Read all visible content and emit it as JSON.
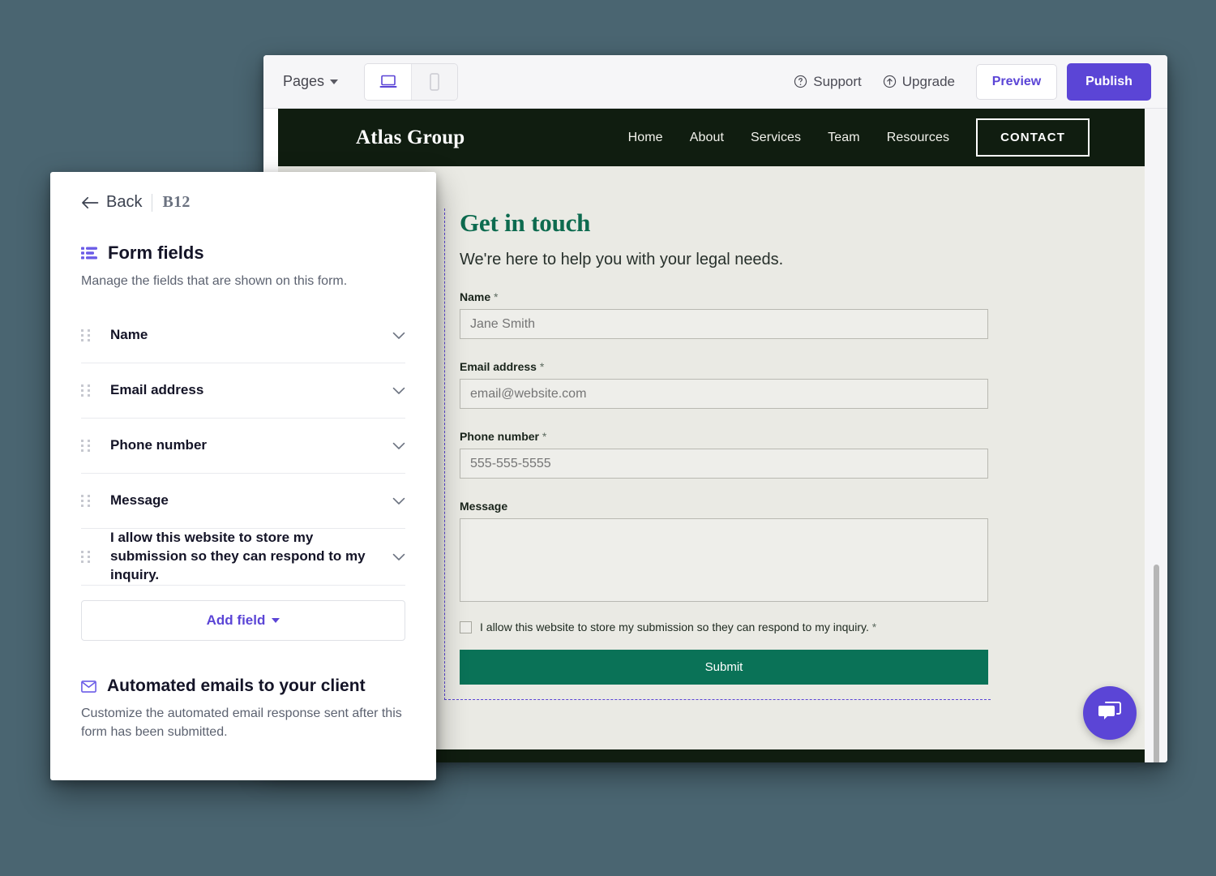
{
  "builder": {
    "toolbar": {
      "pages_label": "Pages",
      "view_desktop_icon": "laptop-icon",
      "view_mobile_icon": "mobile-icon",
      "support_label": "Support",
      "support_icon": "question-circle-icon",
      "upgrade_label": "Upgrade",
      "upgrade_icon": "arrow-up-circle-icon",
      "preview_label": "Preview",
      "publish_label": "Publish",
      "accent_color": "#5b45d6"
    }
  },
  "site": {
    "brand": "Atlas Group",
    "header_bg": "#101d10",
    "nav": [
      {
        "label": "Home"
      },
      {
        "label": "About"
      },
      {
        "label": "Services"
      },
      {
        "label": "Team"
      },
      {
        "label": "Resources"
      }
    ],
    "nav_cta": "CONTACT",
    "page_bg": "#eaeae4",
    "form": {
      "headline": "Get in touch",
      "headline_color": "#0d6b4f",
      "subhead": "We're here to help you with your legal needs.",
      "fields": [
        {
          "label": "Name",
          "required": "*",
          "placeholder": "Jane Smith",
          "type": "text"
        },
        {
          "label": "Email address",
          "required": "*",
          "placeholder": "email@website.com",
          "type": "text"
        },
        {
          "label": "Phone number",
          "required": "*",
          "placeholder": "555-555-5555",
          "type": "text"
        },
        {
          "label": "Message",
          "required": "",
          "placeholder": "",
          "type": "textarea"
        }
      ],
      "consent_text": "I allow this website to store my submission so they can respond to my inquiry.",
      "consent_required": "*",
      "submit_label": "Submit",
      "submit_color": "#0a7257"
    },
    "chat_icon": "chat-bubble-icon"
  },
  "panel": {
    "back_label": "Back",
    "back_icon": "arrow-left-icon",
    "brand_mark": "B12",
    "form_fields": {
      "icon": "list-icon",
      "title": "Form fields",
      "description": "Manage the fields that are shown on this form.",
      "items": [
        {
          "label": "Name"
        },
        {
          "label": "Email address"
        },
        {
          "label": "Phone number"
        },
        {
          "label": "Message"
        },
        {
          "label": "I allow this website to store my submission so they can respond to my inquiry."
        }
      ],
      "add_field_label": "Add field"
    },
    "automated_emails": {
      "icon": "envelope-icon",
      "title": "Automated emails to your client",
      "description": "Customize the automated email response sent after this form has been submitted."
    }
  }
}
